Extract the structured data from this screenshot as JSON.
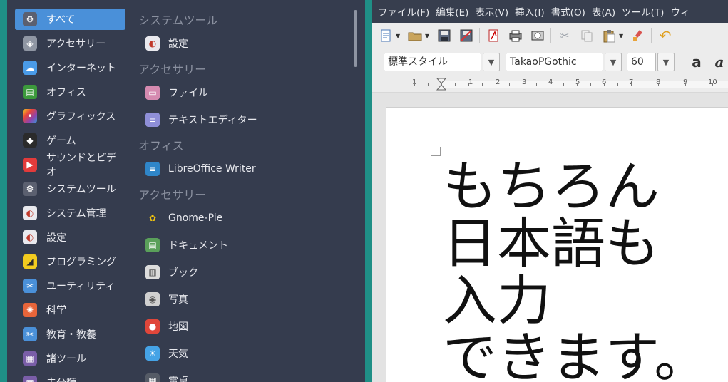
{
  "menu": {
    "categories": [
      {
        "label": "すべて",
        "icon": "gear-icon",
        "color": "#5b6070"
      },
      {
        "label": "アクセサリー",
        "icon": "accessories-icon",
        "color": "#8f96a3"
      },
      {
        "label": "インターネット",
        "icon": "cloud-icon",
        "color": "#4a9be8"
      },
      {
        "label": "オフィス",
        "icon": "office-icon",
        "color": "#3c9a3c"
      },
      {
        "label": "グラフィックス",
        "icon": "graphics-icon",
        "color": "#d7336f"
      },
      {
        "label": "ゲーム",
        "icon": "game-icon",
        "color": "#2b2b2b"
      },
      {
        "label": "サウンドとビデオ",
        "icon": "play-icon",
        "color": "#e33b3b"
      },
      {
        "label": "システムツール",
        "icon": "gear-icon",
        "color": "#5b6070"
      },
      {
        "label": "システム管理",
        "icon": "toggle-icon",
        "color": "#e9e9ee"
      },
      {
        "label": "設定",
        "icon": "toggle-icon",
        "color": "#e9e9ee"
      },
      {
        "label": "プログラミング",
        "icon": "programming-icon",
        "color": "#f3cc1f"
      },
      {
        "label": "ユーティリティ",
        "icon": "scissors-icon",
        "color": "#4a90d9"
      },
      {
        "label": "科学",
        "icon": "science-icon",
        "color": "#e8653a"
      },
      {
        "label": "教育・教養",
        "icon": "scissors-icon",
        "color": "#4a90d9"
      },
      {
        "label": "諸ツール",
        "icon": "grid-icon",
        "color": "#7a5ea8"
      },
      {
        "label": "未分類",
        "icon": "grid-icon",
        "color": "#7a5ea8"
      }
    ],
    "sections": [
      {
        "title": "システムツール",
        "apps": [
          {
            "label": "設定",
            "icon": "toggle-icon",
            "color": "#e9e9ee"
          }
        ]
      },
      {
        "title": "アクセサリー",
        "apps": [
          {
            "label": "ファイル",
            "icon": "folder-icon",
            "color": "#d58ab0"
          },
          {
            "label": "テキストエディター",
            "icon": "text-editor-icon",
            "color": "#8f8fd8"
          }
        ]
      },
      {
        "title": "オフィス",
        "apps": [
          {
            "label": "LibreOffice Writer",
            "icon": "writer-icon",
            "color": "#2f86c9"
          }
        ]
      },
      {
        "title": "アクセサリー",
        "apps": [
          {
            "label": "Gnome-Pie",
            "icon": "pie-icon",
            "color": "#353c4e"
          },
          {
            "label": "ドキュメント",
            "icon": "document-icon",
            "color": "#5aa05a"
          },
          {
            "label": "ブック",
            "icon": "book-icon",
            "color": "#dcdcdc"
          },
          {
            "label": "写真",
            "icon": "camera-icon",
            "color": "#d0d0d0"
          },
          {
            "label": "地図",
            "icon": "map-pin-icon",
            "color": "#e0463a"
          },
          {
            "label": "天気",
            "icon": "weather-icon",
            "color": "#45a3e6"
          },
          {
            "label": "電卓",
            "icon": "calculator-icon",
            "color": "#555b66"
          }
        ]
      }
    ]
  },
  "writer": {
    "menubar": [
      "ファイル(F)",
      "編集(E)",
      "表示(V)",
      "挿入(I)",
      "書式(O)",
      "表(A)",
      "ツール(T)",
      "ウィ"
    ],
    "style_value": "標準スタイル",
    "font_value": "TakaoPGothic",
    "size_value": "60",
    "ruler_numbers": [
      "1",
      "1",
      "2",
      "3",
      "4",
      "5",
      "6",
      "7",
      "8",
      "9",
      "10"
    ],
    "document_lines": [
      "もちろん",
      "日本語も",
      "入力",
      "できます。"
    ]
  }
}
